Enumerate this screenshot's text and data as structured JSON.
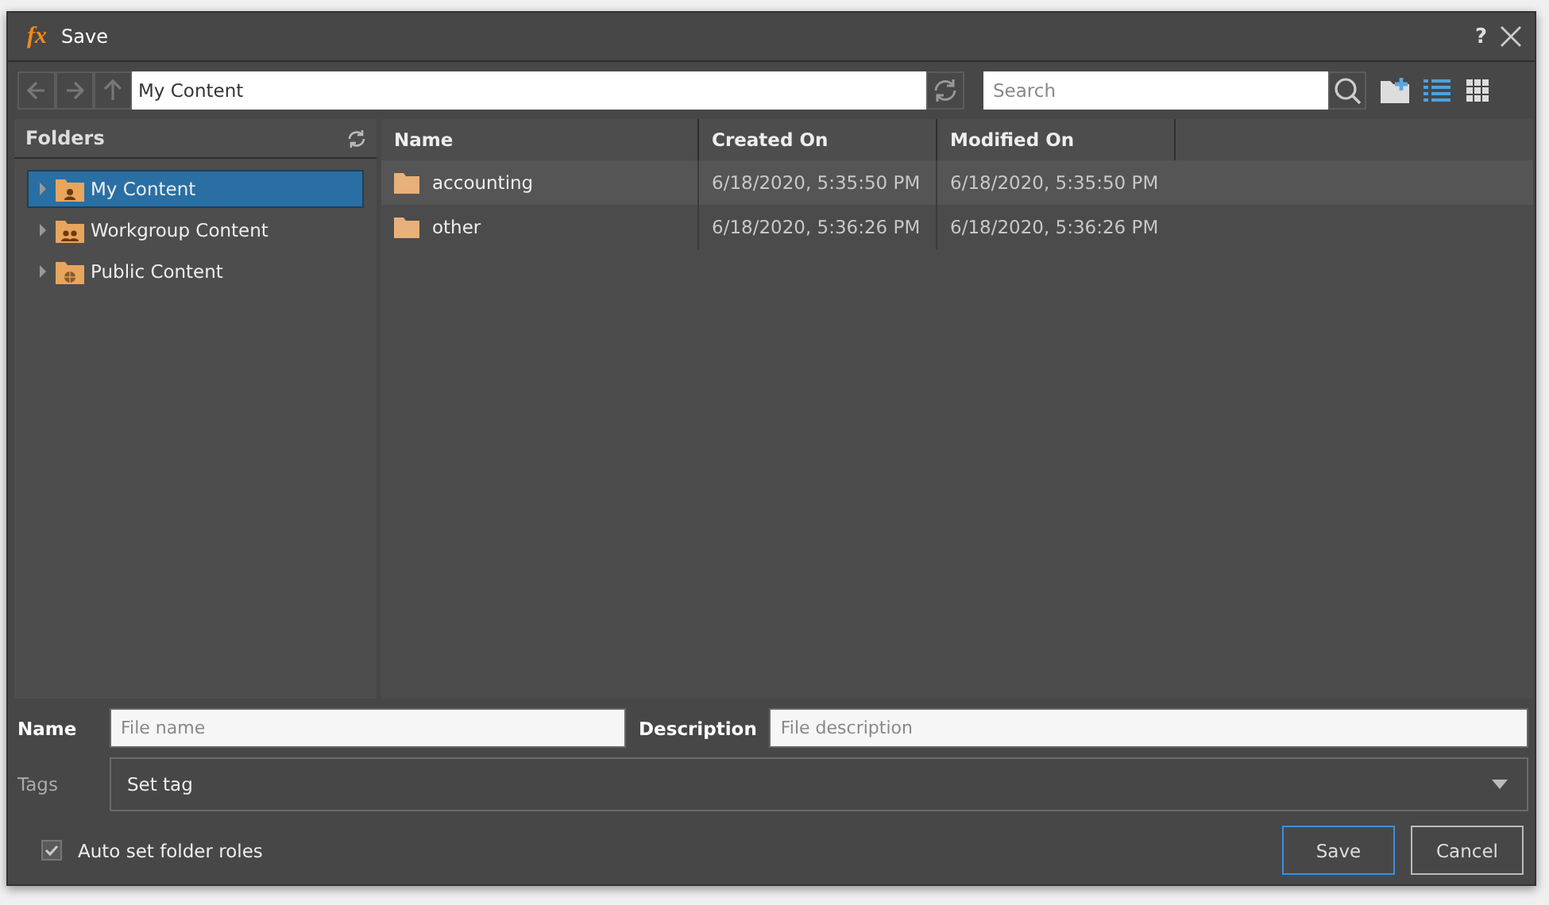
{
  "window": {
    "logo": "fx",
    "title": "Save",
    "help": "?"
  },
  "toolbar": {
    "path": "My Content",
    "search": {
      "placeholder": "Search"
    },
    "views": [
      {
        "kind": "list",
        "selected": true
      },
      {
        "kind": "grid",
        "selected": false
      }
    ]
  },
  "sidebar": {
    "title": "Folders",
    "items": [
      {
        "label": "My Content",
        "kind": "user",
        "selected": true,
        "expanded": false
      },
      {
        "label": "Workgroup Content",
        "kind": "group",
        "selected": false,
        "expanded": false
      },
      {
        "label": "Public Content",
        "kind": "public",
        "selected": false,
        "expanded": false
      }
    ]
  },
  "table": {
    "columns": [
      "Name",
      "Created On",
      "Modified On"
    ],
    "rows": [
      {
        "name": "accounting",
        "created": "6/18/2020, 5:35:50 PM",
        "modified": "6/18/2020, 5:35:50 PM"
      },
      {
        "name": "other",
        "created": "6/18/2020, 5:36:26 PM",
        "modified": "6/18/2020, 5:36:26 PM"
      }
    ]
  },
  "form": {
    "name_label": "Name",
    "name_placeholder": "File name",
    "description_label": "Description",
    "description_placeholder": "File description",
    "tags_label": "Tags",
    "tags_value": "Set tag",
    "auto_roles": {
      "label": "Auto set folder roles",
      "checked": true
    }
  },
  "buttons": [
    {
      "label": "Save",
      "kind": "primary"
    },
    {
      "label": "Cancel",
      "kind": "secondary"
    }
  ]
}
